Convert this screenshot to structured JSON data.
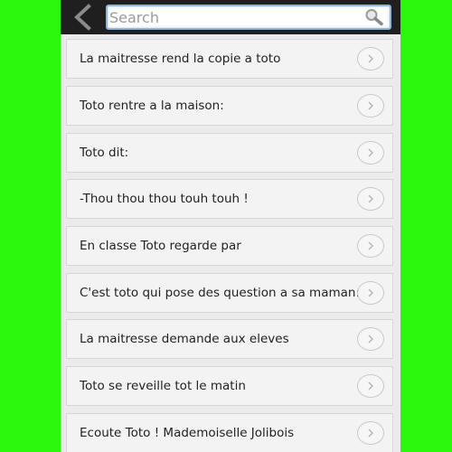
{
  "search": {
    "placeholder": "Search",
    "value": ""
  },
  "icons": {
    "back": "chevron-left-icon",
    "search": "magnifier-icon",
    "item_action": "chevron-right-icon"
  },
  "colors": {
    "background": "#2af70b",
    "topbar": "#1f1f1f",
    "search_border": "#8fb6d8",
    "list_background": "#ebebeb",
    "item_background": "#f3f3f3"
  },
  "list": {
    "items": [
      {
        "label": "La maitresse rend la copie a toto"
      },
      {
        "label": "Toto rentre a la maison:"
      },
      {
        "label": "Toto dit:"
      },
      {
        "label": "-Thou thou thou touh touh !"
      },
      {
        "label": "En classe Toto regarde par"
      },
      {
        "label": "C'est toto qui pose des question a sa maman:"
      },
      {
        "label": "La maitresse demande aux eleves"
      },
      {
        "label": "Toto se reveille tot le matin"
      },
      {
        "label": "Ecoute Toto ! Mademoiselle Jolibois"
      }
    ]
  }
}
